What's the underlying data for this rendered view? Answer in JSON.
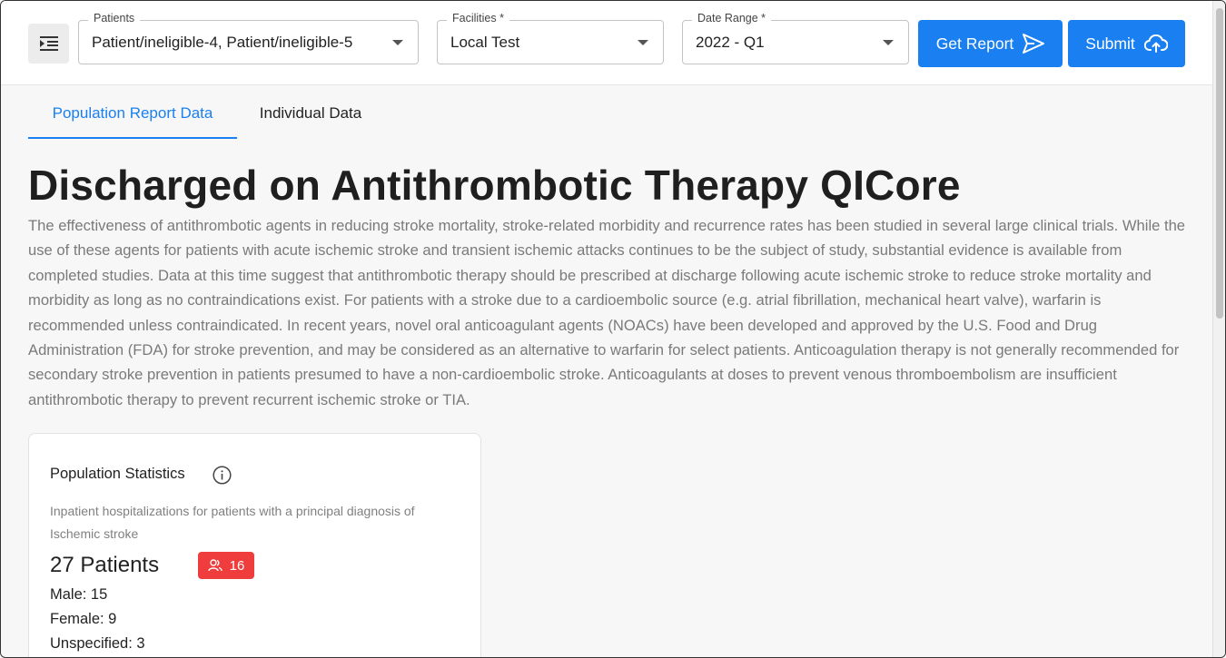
{
  "topbar": {
    "menu_icon": "menu-indent-icon",
    "patients": {
      "label": "Patients",
      "value": "Patient/ineligible-4, Patient/ineligible-5"
    },
    "facilities": {
      "label": "Facilities *",
      "value": "Local Test"
    },
    "date_range": {
      "label": "Date Range *",
      "value": "2022 - Q1"
    },
    "get_report_label": "Get Report",
    "submit_label": "Submit"
  },
  "tabs": [
    {
      "label": "Population Report Data",
      "active": true
    },
    {
      "label": "Individual Data",
      "active": false
    }
  ],
  "main": {
    "title": "Discharged on Antithrombotic Therapy QICore",
    "description": "The effectiveness of antithrombotic agents in reducing stroke mortality, stroke-related morbidity and recurrence rates has been studied in several large clinical trials. While the use of these agents for patients with acute ischemic stroke and transient ischemic attacks continues to be the subject of study, substantial evidence is available from completed studies. Data at this time suggest that antithrombotic therapy should be prescribed at discharge following acute ischemic stroke to reduce stroke mortality and morbidity as long as no contraindications exist. For patients with a stroke due to a cardioembolic source (e.g. atrial fibrillation, mechanical heart valve), warfarin is recommended unless contraindicated. In recent years, novel oral anticoagulant agents (NOACs) have been developed and approved by the U.S. Food and Drug Administration (FDA) for stroke prevention, and may be considered as an alternative to warfarin for select patients. Anticoagulation therapy is not generally recommended for secondary stroke prevention in patients presumed to have a non-cardioembolic stroke. Anticoagulants at doses to prevent venous thromboembolism are insufficient antithrombotic therapy to prevent recurrent ischemic stroke or TIA."
  },
  "population_card": {
    "title": "Population Statistics",
    "subtitle": "Inpatient hospitalizations for patients with a principal diagnosis of Ischemic stroke",
    "count": "27 Patients",
    "badge_value": "16",
    "male": "Male: 15",
    "female": "Female: 9",
    "unspecified": "Unspecified: 3"
  },
  "colors": {
    "accent": "#1a7ff0",
    "badge": "#ef3d3d"
  }
}
